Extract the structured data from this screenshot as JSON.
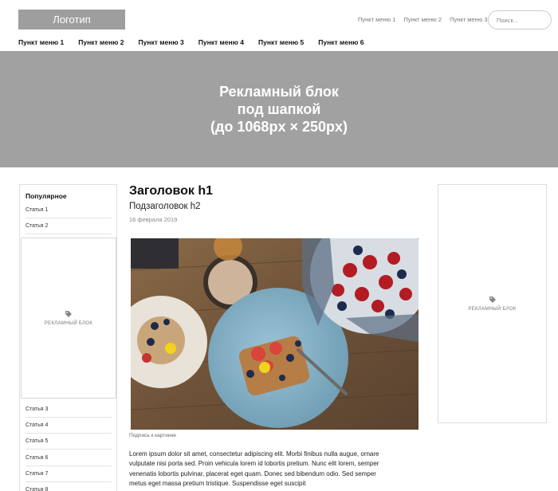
{
  "header": {
    "logo": "Логотип",
    "top_menu": [
      "Пункт меню 1",
      "Пункт меню 2",
      "Пункт меню 3"
    ],
    "search_placeholder": "Поиск..."
  },
  "main_menu": [
    "Пункт меню 1",
    "Пункт меню 2",
    "Пункт меню 3",
    "Пункт меню 4",
    "Пункт меню 5",
    "Пункт меню 6"
  ],
  "banner": {
    "line1": "Рекламный блок",
    "line2": "под шапкой",
    "line3": "(до 1068px × 250px)"
  },
  "sidebar": {
    "title": "Популярное",
    "items": [
      "Статья 1",
      "Статья 2",
      "Статья 3",
      "Статья 4",
      "Статья 5",
      "Статья 6",
      "Статья 7",
      "Статья 8"
    ],
    "ad_label": "РЕКЛАМНЫЙ БЛОК",
    "ad_icon": "tag-icon"
  },
  "right_ad": {
    "label": "РЕКЛАМНЫЙ БЛОК",
    "icon": "tag-icon"
  },
  "article": {
    "h1": "Заголовок h1",
    "h2": "Подзаголовок h2",
    "date": "16 февраля 2019",
    "caption": "Подпись к картинке",
    "body": "Lorem ipsum dolor sit amet, consectetur adipiscing elit. Morbi finibus nulla augue, ornare vulputate nisi porta sed. Proin vehicula lorem id lobortis pretium. Nunc elit lorem, semper venenatis lobortis pulvinar, placerat eget quam. Donec sed bibendum odio. Sed semper metus eget massa pretium tristique. Suspendisse eget suscipit"
  },
  "colors": {
    "banner_bg": "#a1a1a1",
    "logo_bg": "#9e9e9e",
    "border": "#dddddd"
  }
}
